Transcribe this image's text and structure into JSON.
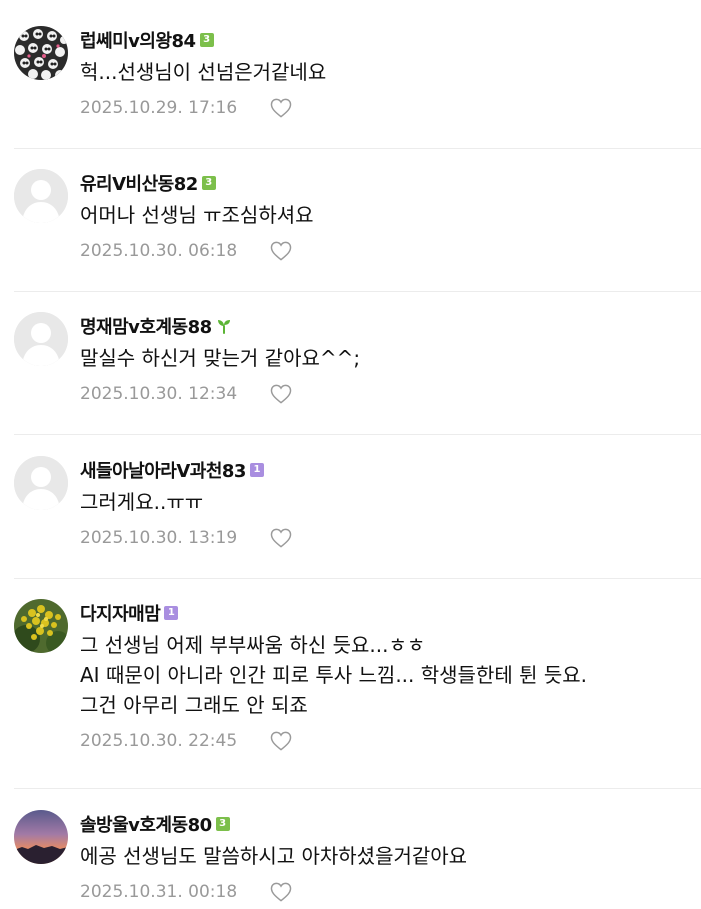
{
  "comments": [
    {
      "author": "럽쎄미v의왕84",
      "badge": {
        "type": "level",
        "text": "3",
        "color": "#7cbf4b"
      },
      "avatar": "panda-pattern-avatar",
      "text": "헉...선생님이 선넘은거같네요",
      "date": "2025.10.29. 17:16"
    },
    {
      "author": "유리V비산동82",
      "badge": {
        "type": "level",
        "text": "3",
        "color": "#7cbf4b"
      },
      "avatar": "default-avatar",
      "text": "어머나 선생님 ㅠ조심하셔요",
      "date": "2025.10.30. 06:18"
    },
    {
      "author": "명재맘v호계동88",
      "badge": {
        "type": "sprout",
        "text": "",
        "color": "#5cb536"
      },
      "avatar": "default-avatar",
      "text": "말실수 하신거 맞는거 같아요^^;",
      "date": "2025.10.30. 12:34"
    },
    {
      "author": "새들아날아라V과천83",
      "badge": {
        "type": "level",
        "text": "1",
        "color": "#a98ee0"
      },
      "avatar": "default-avatar",
      "text": "그러게요..ㅠㅠ",
      "date": "2025.10.30. 13:19"
    },
    {
      "author": "다지자매맘",
      "badge": {
        "type": "level",
        "text": "1",
        "color": "#a98ee0"
      },
      "avatar": "flower-avatar",
      "text": "그 선생님 어제 부부싸움 하신 듯요...ㅎㅎ\nAI 때문이 아니라 인간 피로 투사 느낌... 학생들한테 튄 듯요.\n그건 아무리 그래도 안 되죠",
      "date": "2025.10.30. 22:45"
    },
    {
      "author": "솔방울v호계동80",
      "badge": {
        "type": "level",
        "text": "3",
        "color": "#7cbf4b"
      },
      "avatar": "sunset-avatar",
      "text": "에공 선생님도 말씀하시고 아차하셨을거같아요",
      "date": "2025.10.31. 00:18"
    }
  ],
  "icons": {
    "like": "heart-outline-icon"
  }
}
